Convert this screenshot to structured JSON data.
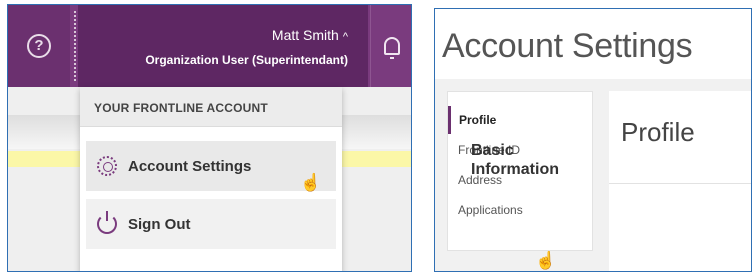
{
  "left_panel": {
    "user": {
      "name": "Matt Smith",
      "caret": "^",
      "role": "Organization User (Superintendant)"
    },
    "help_icon": "?",
    "dropdown": {
      "header": "YOUR FRONTLINE ACCOUNT",
      "items": [
        {
          "label": "Account Settings",
          "icon": "gear-icon"
        },
        {
          "label": "Sign Out",
          "icon": "power-icon"
        }
      ]
    },
    "cursor_glyph": "☝"
  },
  "right_panel": {
    "title": "Account Settings",
    "nav": [
      {
        "label": "Profile",
        "active": true
      },
      {
        "label": "Frontline ID",
        "active": false
      },
      {
        "label": "Address",
        "active": false
      },
      {
        "label": "Applications",
        "active": false
      }
    ],
    "profile_title": "Profile",
    "section_title": "Basic Information",
    "cursor_glyph": "☝"
  },
  "colors": {
    "brand_purple": "#5e2763",
    "accent_purple": "#7a3b7e",
    "highlight_yellow": "#fbf7a7",
    "frame_blue": "#2f6fb3"
  }
}
